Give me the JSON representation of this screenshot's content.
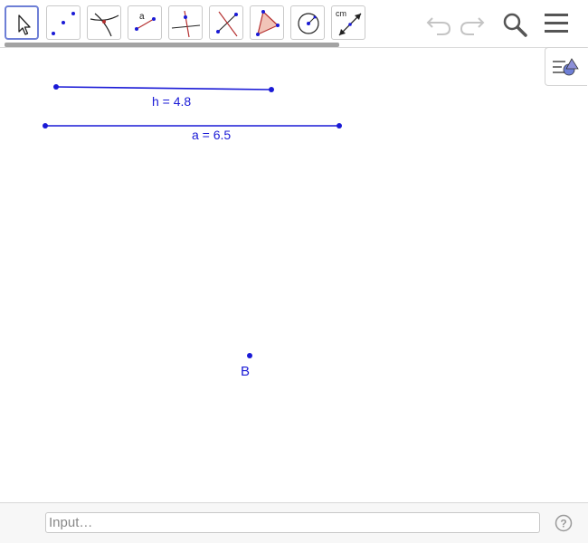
{
  "toolbar": {
    "tools": [
      {
        "name": "move-tool",
        "icon": "arrow-cursor-icon"
      },
      {
        "name": "point-tool",
        "icon": "point-icon"
      },
      {
        "name": "intersect-tool",
        "icon": "intersect-icon"
      },
      {
        "name": "segment-length-tool",
        "icon": "segment-fixed-length-icon",
        "label": "a"
      },
      {
        "name": "perpendicular-tool",
        "icon": "perpendicular-line-icon"
      },
      {
        "name": "perpendicular-bisector-tool",
        "icon": "perpendicular-bisector-icon"
      },
      {
        "name": "polygon-tool",
        "icon": "polygon-icon"
      },
      {
        "name": "circle-tool",
        "icon": "circle-center-point-icon"
      },
      {
        "name": "distance-tool",
        "icon": "distance-length-icon",
        "label": "cm"
      }
    ],
    "accent": "#6e7fd6"
  },
  "graphics": {
    "segment_h": {
      "label": "h = 4.8"
    },
    "segment_a": {
      "label": "a = 6.5"
    },
    "point_b": {
      "label": "B"
    },
    "object_color": "#1a1ad6"
  },
  "inputbar": {
    "placeholder": "Input…"
  }
}
